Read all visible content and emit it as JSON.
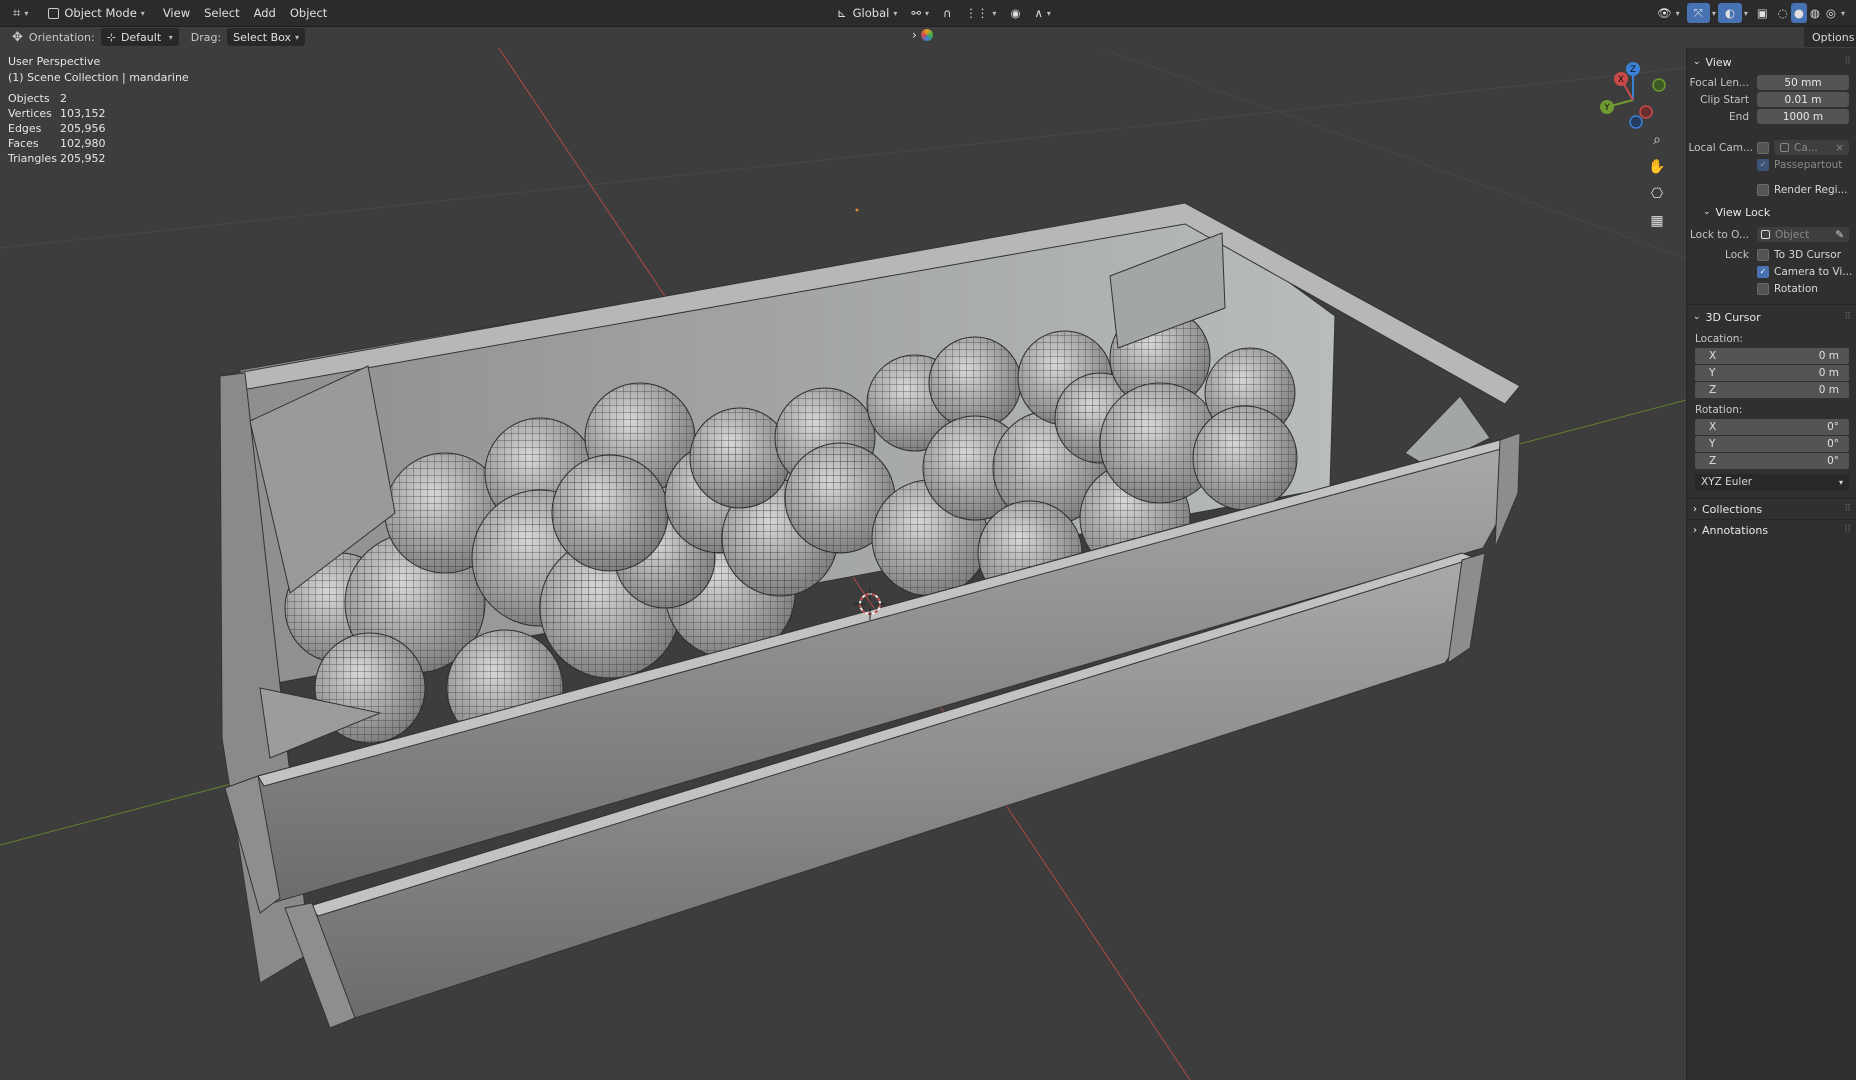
{
  "header": {
    "mode": "Object Mode",
    "menus": [
      "View",
      "Select",
      "Add",
      "Object"
    ],
    "orientation_global": "Global",
    "options_label": "Options"
  },
  "tool_settings": {
    "orientation_label": "Orientation:",
    "orientation_value": "Default",
    "drag_label": "Drag:",
    "drag_value": "Select Box"
  },
  "overlay": {
    "perspective": "User Perspective",
    "collection": "(1) Scene Collection | mandarine",
    "stats": [
      {
        "label": "Objects",
        "value": "2"
      },
      {
        "label": "Vertices",
        "value": "103,152"
      },
      {
        "label": "Edges",
        "value": "205,956"
      },
      {
        "label": "Faces",
        "value": "102,980"
      },
      {
        "label": "Triangles",
        "value": "205,952"
      }
    ]
  },
  "gizmo": {
    "x": "X",
    "y": "Y",
    "z": "Z"
  },
  "panel": {
    "view_title": "View",
    "focal_label": "Focal Len...",
    "focal_value": "50 mm",
    "clip_start_label": "Clip Start",
    "clip_start_value": "0.01 m",
    "end_label": "End",
    "end_value": "1000 m",
    "local_cam_label": "Local Cam...",
    "local_cam_value": "Ca...",
    "passepartout": "Passepartout",
    "render_region": "Render Regi...",
    "view_lock_title": "View Lock",
    "lock_to_label": "Lock to O...",
    "lock_to_placeholder": "Object",
    "lock_label": "Lock",
    "to_cursor": "To 3D Cursor",
    "camera_to_view": "Camera to Vi...",
    "rotation_check": "Rotation",
    "cursor_title": "3D Cursor",
    "location_label": "Location:",
    "location": [
      {
        "axis": "X",
        "value": "0 m"
      },
      {
        "axis": "Y",
        "value": "0 m"
      },
      {
        "axis": "Z",
        "value": "0 m"
      }
    ],
    "rotation_label": "Rotation:",
    "rotation": [
      {
        "axis": "X",
        "value": "0°"
      },
      {
        "axis": "Y",
        "value": "0°"
      },
      {
        "axis": "Z",
        "value": "0°"
      }
    ],
    "rotation_mode": "XYZ Euler",
    "collections_title": "Collections",
    "annotations_title": "Annotations"
  },
  "colors": {
    "accent": "#4772b3",
    "x_axis": "#c94a4a",
    "y_axis": "#6f9b32",
    "z_axis": "#3b7fd6"
  }
}
